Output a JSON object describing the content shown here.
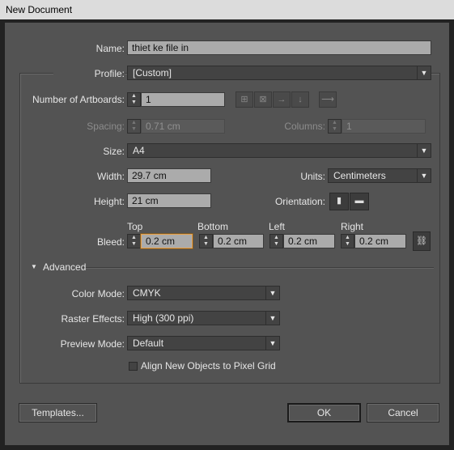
{
  "window": {
    "title": "New Document"
  },
  "name": {
    "label": "Name:",
    "value": "thiet ke file in"
  },
  "profile": {
    "label": "Profile:",
    "value": "[Custom]"
  },
  "artboards": {
    "label": "Number of Artboards:",
    "value": "1"
  },
  "spacing": {
    "label": "Spacing:",
    "value": "0.71 cm"
  },
  "columns": {
    "label": "Columns:",
    "value": "1"
  },
  "size": {
    "label": "Size:",
    "value": "A4"
  },
  "width": {
    "label": "Width:",
    "value": "29.7 cm"
  },
  "units": {
    "label": "Units:",
    "value": "Centimeters"
  },
  "height": {
    "label": "Height:",
    "value": "21 cm"
  },
  "orientation": {
    "label": "Orientation:"
  },
  "bleed": {
    "label": "Bleed:",
    "top": {
      "label": "Top",
      "value": "0.2 cm"
    },
    "bottom": {
      "label": "Bottom",
      "value": "0.2 cm"
    },
    "left": {
      "label": "Left",
      "value": "0.2 cm"
    },
    "right": {
      "label": "Right",
      "value": "0.2 cm"
    }
  },
  "advanced": {
    "label": "Advanced",
    "color_mode": {
      "label": "Color Mode:",
      "value": "CMYK"
    },
    "raster_effects": {
      "label": "Raster Effects:",
      "value": "High (300 ppi)"
    },
    "preview_mode": {
      "label": "Preview Mode:",
      "value": "Default"
    },
    "align_pixel_grid": {
      "label": "Align New Objects to Pixel Grid",
      "checked": false
    }
  },
  "buttons": {
    "templates": "Templates...",
    "ok": "OK",
    "cancel": "Cancel"
  },
  "icons": {
    "spinner": "up-down-arrows-icon",
    "dropdown": "chevron-down-icon",
    "grid_by_row": "grid-by-row-icon",
    "grid_by_column": "grid-by-column-icon",
    "arrange_by_row": "arrange-by-row-icon",
    "arrange_by_column": "arrange-by-column-icon",
    "layout_direction": "right-to-left-icon",
    "portrait": "portrait-icon",
    "landscape": "landscape-icon",
    "link": "link-icon",
    "disclosure": "triangle-down-icon"
  },
  "colors": {
    "accent_focus": "#e8a14a",
    "dialog_bg": "#535353",
    "field_bg": "#ababab"
  }
}
